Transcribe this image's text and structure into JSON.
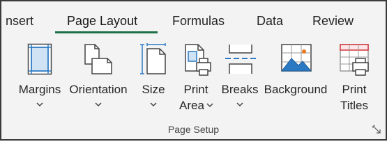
{
  "tabs": [
    {
      "label": "nsert"
    },
    {
      "label": "Page Layout",
      "active": true
    },
    {
      "label": "Formulas"
    },
    {
      "label": "Data"
    },
    {
      "label": "Review"
    }
  ],
  "commands": {
    "margins": {
      "label": "Margins",
      "icon": "margins-icon"
    },
    "orientation": {
      "label": "Orientation",
      "icon": "orientation-icon"
    },
    "size": {
      "label": "Size",
      "icon": "size-icon"
    },
    "print_area": {
      "line1": "Print",
      "line2": "Area",
      "icon": "print-area-icon"
    },
    "breaks": {
      "label": "Breaks",
      "icon": "breaks-icon"
    },
    "background": {
      "label": "Background",
      "icon": "background-icon"
    },
    "print_titles": {
      "line1": "Print",
      "line2": "Titles",
      "icon": "print-titles-icon"
    }
  },
  "group": {
    "label": "Page Setup"
  },
  "colors": {
    "accent": "#1e7145",
    "icon_blue": "#2b79c2",
    "icon_red": "#d13438",
    "icon_orange": "#e97a1b"
  }
}
